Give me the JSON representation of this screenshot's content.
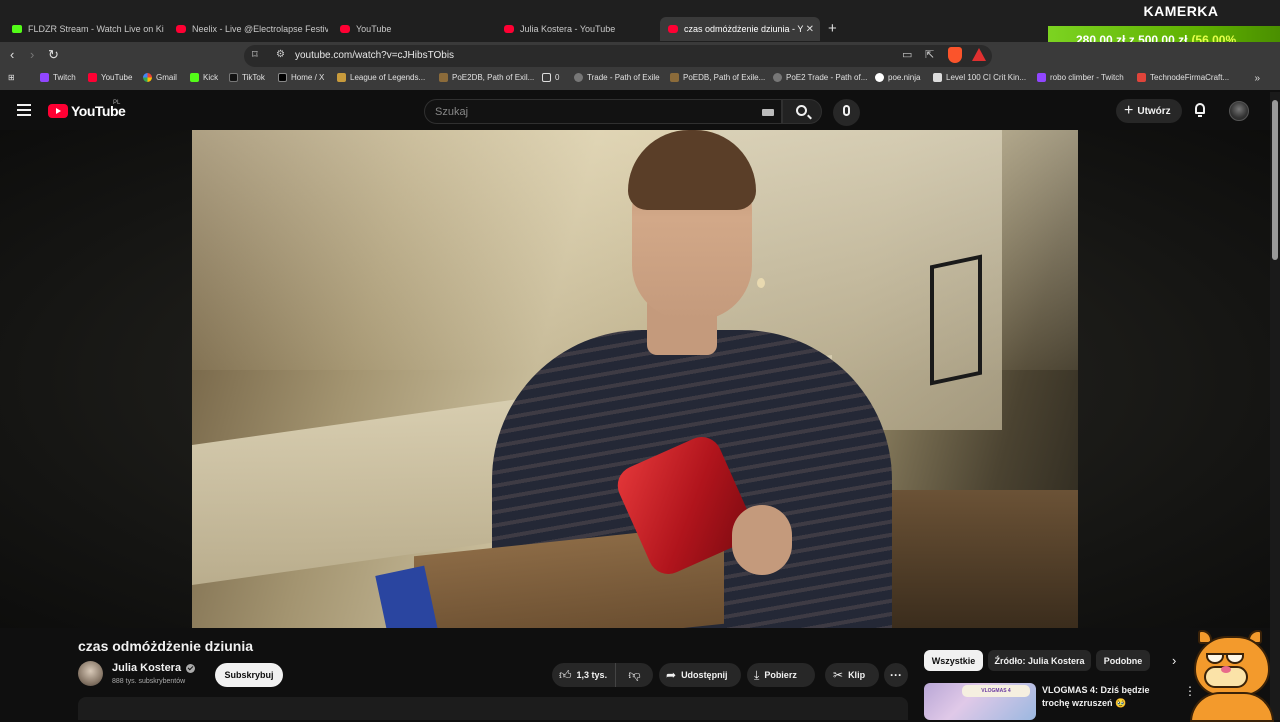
{
  "browser": {
    "tabs": [
      {
        "label": "FLDZR Stream - Watch Live on Kick",
        "icon": "kick-icon",
        "active": false
      },
      {
        "label": "Neelix - Live @Electrolapse Festival 2",
        "icon": "youtube-icon",
        "active": false
      },
      {
        "label": "YouTube",
        "icon": "youtube-icon",
        "active": false
      },
      {
        "label": "Julia Kostera - YouTube",
        "icon": "youtube-icon",
        "active": false
      },
      {
        "label": "czas odmóżdżenie dziunia - Y",
        "icon": "youtube-icon",
        "active": true
      }
    ],
    "new_tab_symbol": "+",
    "close_symbol": "✕",
    "url": "youtube.com/watch?v=cJHibsTObis",
    "bookmarks": [
      {
        "label": "Twitch",
        "icon": "twitch-icon"
      },
      {
        "label": "YouTube",
        "icon": "youtube-icon"
      },
      {
        "label": "Gmail",
        "icon": "google-icon"
      },
      {
        "label": "Kick",
        "icon": "kick-icon"
      },
      {
        "label": "TikTok",
        "icon": "tiktok-icon"
      },
      {
        "label": "Home / X",
        "icon": "x-icon"
      },
      {
        "label": "League of Legends...",
        "icon": "lol-icon"
      },
      {
        "label": "PoE2DB, Path of Exil...",
        "icon": "poe-icon"
      },
      {
        "label": "0",
        "icon": "folder-icon"
      },
      {
        "label": "Trade - Path of Exile",
        "icon": "trade-icon"
      },
      {
        "label": "PoEDB, Path of Exile...",
        "icon": "poe-icon"
      },
      {
        "label": "PoE2 Trade - Path of...",
        "icon": "trade-icon"
      },
      {
        "label": "poe.ninja",
        "icon": "ninja-icon"
      },
      {
        "label": "Level 100 CI Crit Kin...",
        "icon": "doc-icon"
      },
      {
        "label": "robo climber - Twitch",
        "icon": "twitch-icon"
      },
      {
        "label": "TechnodeFirmaCraft...",
        "icon": "technode-icon"
      }
    ],
    "bookmarks_more": "»"
  },
  "overlay": {
    "title": "KAMERKA",
    "current": "280,00 zł",
    "separator": "z",
    "goal": "500,00 zł",
    "percent": "(56.00%",
    "progress_fraction": 0.56
  },
  "youtube": {
    "logo_text": "YouTube",
    "region": "PL",
    "search_placeholder": "Szukaj",
    "create_label": "Utwórz",
    "video": {
      "title": "czas odmóżdżenie dziunia",
      "channel": "Julia Kostera",
      "subscribers": "888 tys. subskrybentów",
      "subscribe_label": "Subskrybuj",
      "likes": "1,3 tys.",
      "share_label": "Udostępnij",
      "download_label": "Pobierz",
      "clip_label": "Klip",
      "more_symbol": "···"
    },
    "chips": [
      "Wszystkie",
      "Źródło: Julia Kostera",
      "Podobne"
    ],
    "chip_next": "›",
    "recommendation": {
      "title": "VLOGMAS 4: Dziś będzie trochę wzruszeń 🥹",
      "thumb_text": "VLOGMAS 4"
    }
  },
  "colors": {
    "youtube_red": "#ff0033",
    "kick_green": "#53fc18",
    "overlay_green": "#5fb000"
  }
}
